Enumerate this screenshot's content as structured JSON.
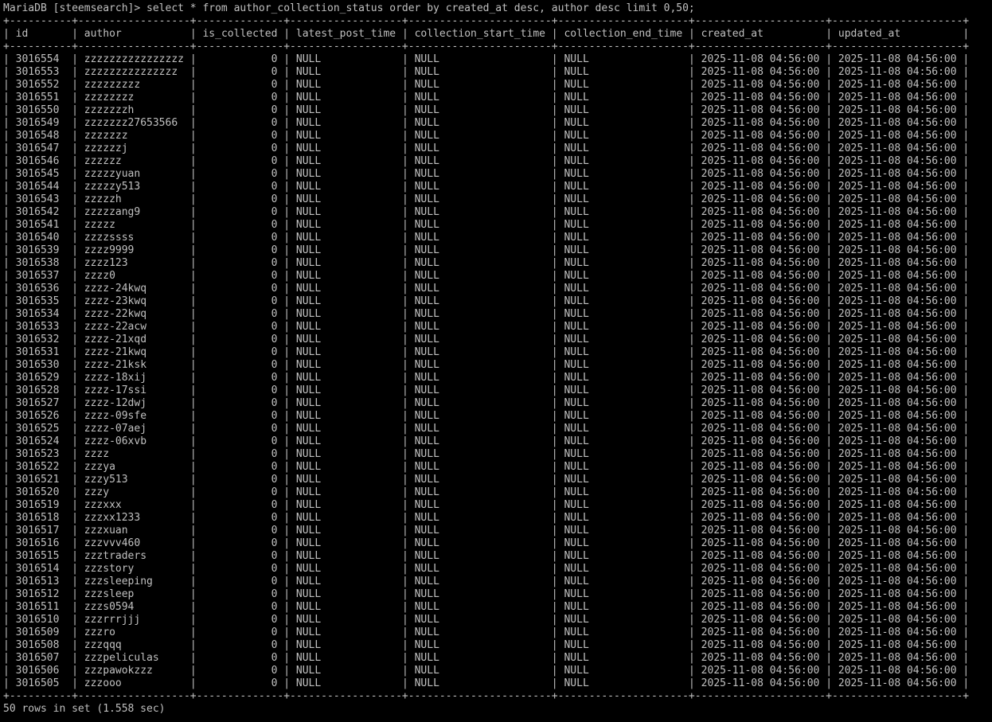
{
  "terminal": {
    "prompt": "MariaDB [steemsearch]>",
    "command": "select * from author_collection_status order by created_at desc, author desc limit 0,50;",
    "footer": "50 rows in set (1.558 sec)",
    "foreground": "#c0c0c0",
    "background": "#000000"
  },
  "table": {
    "columns": [
      "id",
      "author",
      "is_collected",
      "latest_post_time",
      "collection_start_time",
      "collection_end_time",
      "created_at",
      "updated_at"
    ],
    "rows": [
      [
        "3016554",
        "zzzzzzzzzzzzzzzz",
        "0",
        "NULL",
        "NULL",
        "NULL",
        "2025-11-08 04:56:00",
        "2025-11-08 04:56:00"
      ],
      [
        "3016553",
        "zzzzzzzzzzzzzzz",
        "0",
        "NULL",
        "NULL",
        "NULL",
        "2025-11-08 04:56:00",
        "2025-11-08 04:56:00"
      ],
      [
        "3016552",
        "zzzzzzzzz",
        "0",
        "NULL",
        "NULL",
        "NULL",
        "2025-11-08 04:56:00",
        "2025-11-08 04:56:00"
      ],
      [
        "3016551",
        "zzzzzzzz",
        "0",
        "NULL",
        "NULL",
        "NULL",
        "2025-11-08 04:56:00",
        "2025-11-08 04:56:00"
      ],
      [
        "3016550",
        "zzzzzzzh",
        "0",
        "NULL",
        "NULL",
        "NULL",
        "2025-11-08 04:56:00",
        "2025-11-08 04:56:00"
      ],
      [
        "3016549",
        "zzzzzzz27653566",
        "0",
        "NULL",
        "NULL",
        "NULL",
        "2025-11-08 04:56:00",
        "2025-11-08 04:56:00"
      ],
      [
        "3016548",
        "zzzzzzz",
        "0",
        "NULL",
        "NULL",
        "NULL",
        "2025-11-08 04:56:00",
        "2025-11-08 04:56:00"
      ],
      [
        "3016547",
        "zzzzzzj",
        "0",
        "NULL",
        "NULL",
        "NULL",
        "2025-11-08 04:56:00",
        "2025-11-08 04:56:00"
      ],
      [
        "3016546",
        "zzzzzz",
        "0",
        "NULL",
        "NULL",
        "NULL",
        "2025-11-08 04:56:00",
        "2025-11-08 04:56:00"
      ],
      [
        "3016545",
        "zzzzzyuan",
        "0",
        "NULL",
        "NULL",
        "NULL",
        "2025-11-08 04:56:00",
        "2025-11-08 04:56:00"
      ],
      [
        "3016544",
        "zzzzzy513",
        "0",
        "NULL",
        "NULL",
        "NULL",
        "2025-11-08 04:56:00",
        "2025-11-08 04:56:00"
      ],
      [
        "3016543",
        "zzzzzh",
        "0",
        "NULL",
        "NULL",
        "NULL",
        "2025-11-08 04:56:00",
        "2025-11-08 04:56:00"
      ],
      [
        "3016542",
        "zzzzzang9",
        "0",
        "NULL",
        "NULL",
        "NULL",
        "2025-11-08 04:56:00",
        "2025-11-08 04:56:00"
      ],
      [
        "3016541",
        "zzzzz",
        "0",
        "NULL",
        "NULL",
        "NULL",
        "2025-11-08 04:56:00",
        "2025-11-08 04:56:00"
      ],
      [
        "3016540",
        "zzzzssss",
        "0",
        "NULL",
        "NULL",
        "NULL",
        "2025-11-08 04:56:00",
        "2025-11-08 04:56:00"
      ],
      [
        "3016539",
        "zzzz9999",
        "0",
        "NULL",
        "NULL",
        "NULL",
        "2025-11-08 04:56:00",
        "2025-11-08 04:56:00"
      ],
      [
        "3016538",
        "zzzz123",
        "0",
        "NULL",
        "NULL",
        "NULL",
        "2025-11-08 04:56:00",
        "2025-11-08 04:56:00"
      ],
      [
        "3016537",
        "zzzz0",
        "0",
        "NULL",
        "NULL",
        "NULL",
        "2025-11-08 04:56:00",
        "2025-11-08 04:56:00"
      ],
      [
        "3016536",
        "zzzz-24kwq",
        "0",
        "NULL",
        "NULL",
        "NULL",
        "2025-11-08 04:56:00",
        "2025-11-08 04:56:00"
      ],
      [
        "3016535",
        "zzzz-23kwq",
        "0",
        "NULL",
        "NULL",
        "NULL",
        "2025-11-08 04:56:00",
        "2025-11-08 04:56:00"
      ],
      [
        "3016534",
        "zzzz-22kwq",
        "0",
        "NULL",
        "NULL",
        "NULL",
        "2025-11-08 04:56:00",
        "2025-11-08 04:56:00"
      ],
      [
        "3016533",
        "zzzz-22acw",
        "0",
        "NULL",
        "NULL",
        "NULL",
        "2025-11-08 04:56:00",
        "2025-11-08 04:56:00"
      ],
      [
        "3016532",
        "zzzz-21xqd",
        "0",
        "NULL",
        "NULL",
        "NULL",
        "2025-11-08 04:56:00",
        "2025-11-08 04:56:00"
      ],
      [
        "3016531",
        "zzzz-21kwq",
        "0",
        "NULL",
        "NULL",
        "NULL",
        "2025-11-08 04:56:00",
        "2025-11-08 04:56:00"
      ],
      [
        "3016530",
        "zzzz-21ksk",
        "0",
        "NULL",
        "NULL",
        "NULL",
        "2025-11-08 04:56:00",
        "2025-11-08 04:56:00"
      ],
      [
        "3016529",
        "zzzz-18xij",
        "0",
        "NULL",
        "NULL",
        "NULL",
        "2025-11-08 04:56:00",
        "2025-11-08 04:56:00"
      ],
      [
        "3016528",
        "zzzz-17ssi",
        "0",
        "NULL",
        "NULL",
        "NULL",
        "2025-11-08 04:56:00",
        "2025-11-08 04:56:00"
      ],
      [
        "3016527",
        "zzzz-12dwj",
        "0",
        "NULL",
        "NULL",
        "NULL",
        "2025-11-08 04:56:00",
        "2025-11-08 04:56:00"
      ],
      [
        "3016526",
        "zzzz-09sfe",
        "0",
        "NULL",
        "NULL",
        "NULL",
        "2025-11-08 04:56:00",
        "2025-11-08 04:56:00"
      ],
      [
        "3016525",
        "zzzz-07aej",
        "0",
        "NULL",
        "NULL",
        "NULL",
        "2025-11-08 04:56:00",
        "2025-11-08 04:56:00"
      ],
      [
        "3016524",
        "zzzz-06xvb",
        "0",
        "NULL",
        "NULL",
        "NULL",
        "2025-11-08 04:56:00",
        "2025-11-08 04:56:00"
      ],
      [
        "3016523",
        "zzzz",
        "0",
        "NULL",
        "NULL",
        "NULL",
        "2025-11-08 04:56:00",
        "2025-11-08 04:56:00"
      ],
      [
        "3016522",
        "zzzya",
        "0",
        "NULL",
        "NULL",
        "NULL",
        "2025-11-08 04:56:00",
        "2025-11-08 04:56:00"
      ],
      [
        "3016521",
        "zzzy513",
        "0",
        "NULL",
        "NULL",
        "NULL",
        "2025-11-08 04:56:00",
        "2025-11-08 04:56:00"
      ],
      [
        "3016520",
        "zzzy",
        "0",
        "NULL",
        "NULL",
        "NULL",
        "2025-11-08 04:56:00",
        "2025-11-08 04:56:00"
      ],
      [
        "3016519",
        "zzzxxx",
        "0",
        "NULL",
        "NULL",
        "NULL",
        "2025-11-08 04:56:00",
        "2025-11-08 04:56:00"
      ],
      [
        "3016518",
        "zzzxx1233",
        "0",
        "NULL",
        "NULL",
        "NULL",
        "2025-11-08 04:56:00",
        "2025-11-08 04:56:00"
      ],
      [
        "3016517",
        "zzzxuan",
        "0",
        "NULL",
        "NULL",
        "NULL",
        "2025-11-08 04:56:00",
        "2025-11-08 04:56:00"
      ],
      [
        "3016516",
        "zzzvvv460",
        "0",
        "NULL",
        "NULL",
        "NULL",
        "2025-11-08 04:56:00",
        "2025-11-08 04:56:00"
      ],
      [
        "3016515",
        "zzztraders",
        "0",
        "NULL",
        "NULL",
        "NULL",
        "2025-11-08 04:56:00",
        "2025-11-08 04:56:00"
      ],
      [
        "3016514",
        "zzzstory",
        "0",
        "NULL",
        "NULL",
        "NULL",
        "2025-11-08 04:56:00",
        "2025-11-08 04:56:00"
      ],
      [
        "3016513",
        "zzzsleeping",
        "0",
        "NULL",
        "NULL",
        "NULL",
        "2025-11-08 04:56:00",
        "2025-11-08 04:56:00"
      ],
      [
        "3016512",
        "zzzsleep",
        "0",
        "NULL",
        "NULL",
        "NULL",
        "2025-11-08 04:56:00",
        "2025-11-08 04:56:00"
      ],
      [
        "3016511",
        "zzzs0594",
        "0",
        "NULL",
        "NULL",
        "NULL",
        "2025-11-08 04:56:00",
        "2025-11-08 04:56:00"
      ],
      [
        "3016510",
        "zzzrrrjjj",
        "0",
        "NULL",
        "NULL",
        "NULL",
        "2025-11-08 04:56:00",
        "2025-11-08 04:56:00"
      ],
      [
        "3016509",
        "zzzro",
        "0",
        "NULL",
        "NULL",
        "NULL",
        "2025-11-08 04:56:00",
        "2025-11-08 04:56:00"
      ],
      [
        "3016508",
        "zzzqqq",
        "0",
        "NULL",
        "NULL",
        "NULL",
        "2025-11-08 04:56:00",
        "2025-11-08 04:56:00"
      ],
      [
        "3016507",
        "zzzpeliculas",
        "0",
        "NULL",
        "NULL",
        "NULL",
        "2025-11-08 04:56:00",
        "2025-11-08 04:56:00"
      ],
      [
        "3016506",
        "zzzpawokzzz",
        "0",
        "NULL",
        "NULL",
        "NULL",
        "2025-11-08 04:56:00",
        "2025-11-08 04:56:00"
      ],
      [
        "3016505",
        "zzzooo",
        "0",
        "NULL",
        "NULL",
        "NULL",
        "2025-11-08 04:56:00",
        "2025-11-08 04:56:00"
      ]
    ]
  }
}
